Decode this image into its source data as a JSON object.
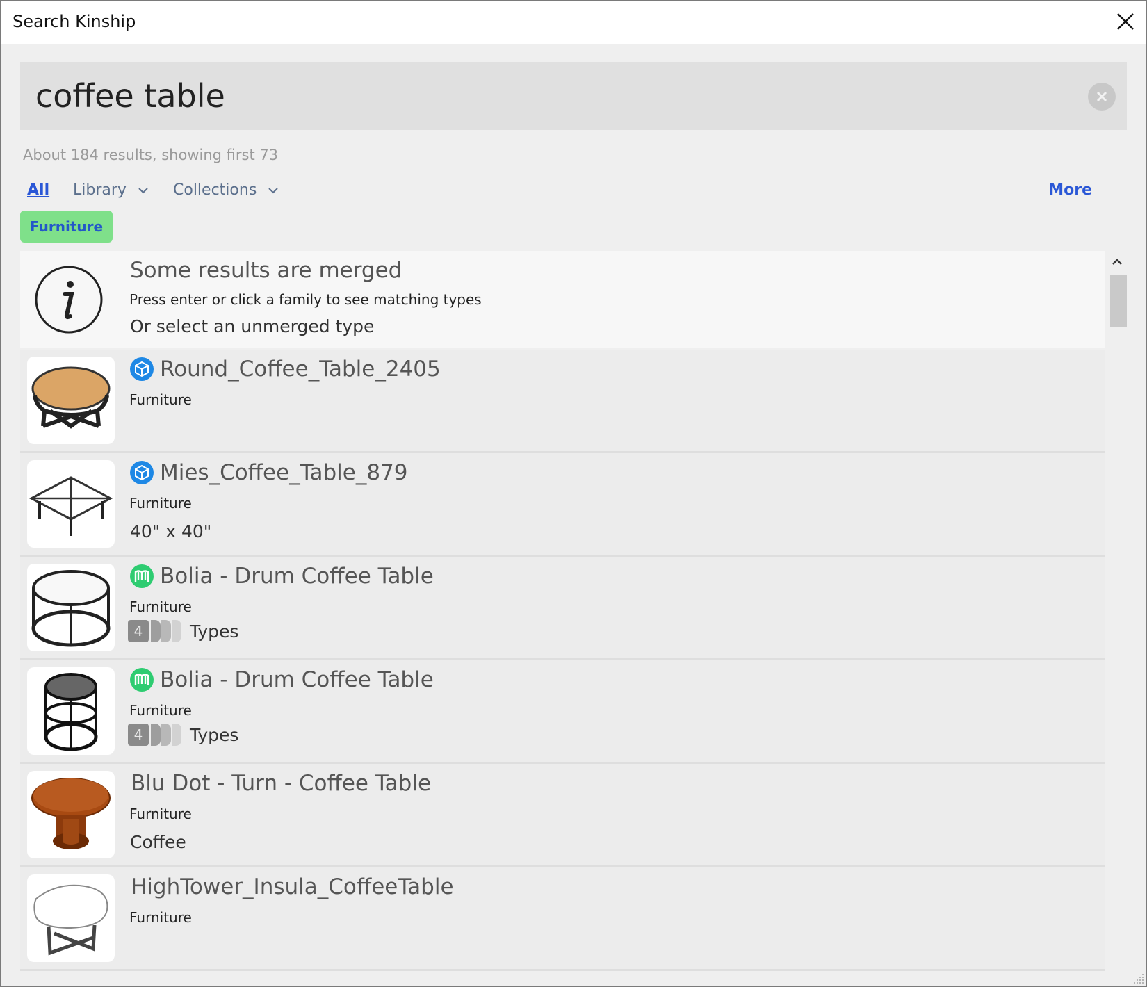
{
  "window": {
    "title": "Search Kinship"
  },
  "search": {
    "value": "coffee table"
  },
  "result_count": "About 184 results, showing first 73",
  "filters": {
    "all": "All",
    "library": "Library",
    "collections": "Collections",
    "more": "More"
  },
  "active_chip": "Furniture",
  "info": {
    "title": "Some results are merged",
    "line1": "Press enter or click a family to see matching types",
    "line2": "Or select an unmerged type"
  },
  "results": [
    {
      "title": "Round_Coffee_Table_2405",
      "category": "Furniture",
      "source_icon": "cube-icon",
      "extra": ""
    },
    {
      "title": "Mies_Coffee_Table_879",
      "category": "Furniture",
      "source_icon": "cube-icon",
      "extra": "40\" x 40\""
    },
    {
      "title": "Bolia - Drum Coffee Table",
      "category": "Furniture",
      "source_icon": "manufacturer-icon",
      "types_count": "4",
      "types_label": "Types"
    },
    {
      "title": "Bolia - Drum Coffee Table",
      "category": "Furniture",
      "source_icon": "manufacturer-icon",
      "types_count": "4",
      "types_label": "Types"
    },
    {
      "title": "Blu Dot - Turn - Coffee Table",
      "category": "Furniture",
      "extra": "Coffee"
    },
    {
      "title": "HighTower_Insula_CoffeeTable",
      "category": "Furniture",
      "extra": ""
    }
  ],
  "colors": {
    "accent_blue": "#2a57d6",
    "chip_green": "#7fe08a",
    "cube_blue": "#1e88e5",
    "manufacturer_green": "#2ecc71"
  }
}
